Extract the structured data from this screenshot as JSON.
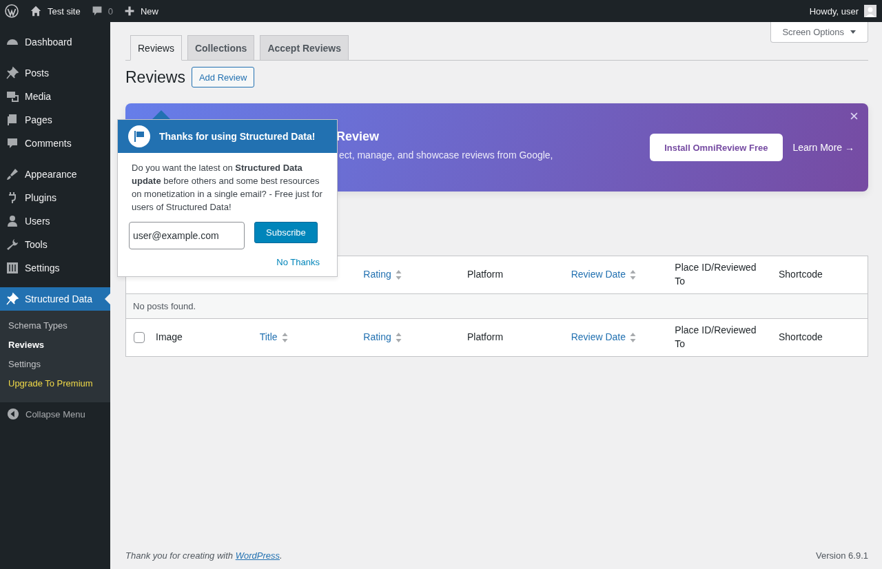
{
  "admin_bar": {
    "site": "Test site",
    "comments": "0",
    "new": "New",
    "greeting": "Howdy, user"
  },
  "sidebar": {
    "groups": [
      [
        {
          "label": "Dashboard",
          "selected": false
        }
      ],
      [
        {
          "label": "Posts",
          "selected": false
        },
        {
          "label": "Media",
          "selected": false
        },
        {
          "label": "Pages",
          "selected": false
        },
        {
          "label": "Comments",
          "selected": false
        }
      ],
      [
        {
          "label": "Appearance",
          "selected": false
        },
        {
          "label": "Plugins",
          "selected": false
        },
        {
          "label": "Users",
          "selected": false
        },
        {
          "label": "Tools",
          "selected": false
        },
        {
          "label": "Settings",
          "selected": false
        }
      ],
      [
        {
          "label": "Structured Data",
          "selected": true
        }
      ]
    ],
    "submenu": [
      {
        "label": "Schema Types",
        "selected": false,
        "kind": "link"
      },
      {
        "label": "Reviews",
        "selected": true,
        "kind": "link"
      },
      {
        "label": "Settings",
        "selected": false,
        "kind": "link"
      },
      {
        "label": "Upgrade To Premium",
        "selected": false,
        "kind": "premium"
      }
    ],
    "collapse": "Collapse Menu"
  },
  "screen_options": "Screen Options",
  "tabs": [
    {
      "label": "Reviews",
      "selected": true
    },
    {
      "label": "Collections",
      "selected": false
    },
    {
      "label": "Accept Reviews",
      "selected": false
    }
  ],
  "page_title": "Reviews",
  "add_button": "Add Review",
  "banner": {
    "title": "Review",
    "text": "ect, manage, and showcase reviews from Google,",
    "install": "Install OmniReview Free",
    "learn_more": "Learn More →"
  },
  "popup": {
    "title": "Thanks for using Structured Data!",
    "body": "Do you want the latest on **Structured Data update** before others and some best resources on monetization in a single email? - Free just for users of Structured Data!",
    "email": "user@example.com",
    "subscribe": "Subscribe",
    "dismiss": "No Thanks"
  },
  "table": {
    "header_columns": [
      {
        "label": "Rating",
        "sortable": true
      },
      {
        "label": "Platform",
        "sortable": false
      },
      {
        "label": "Review Date",
        "sortable": true
      },
      {
        "label": "Place ID/Reviewed To",
        "sortable": false
      },
      {
        "label": "Shortcode",
        "sortable": false
      }
    ],
    "empty": "No posts found.",
    "footer_checkbox": {
      "checked": false
    },
    "footer_columns": [
      {
        "label": "Image",
        "sortable": false
      },
      {
        "label": "Title",
        "sortable": true
      },
      {
        "label": "Rating",
        "sortable": true
      },
      {
        "label": "Platform",
        "sortable": false
      },
      {
        "label": "Review Date",
        "sortable": true
      },
      {
        "label": "Place ID/Reviewed To",
        "sortable": false
      },
      {
        "label": "Shortcode",
        "sortable": false
      }
    ]
  },
  "footer": {
    "thanks_before": "Thank you for creating with ",
    "link": "WordPress",
    "thanks_after": ".",
    "version": "Version 6.9.1"
  }
}
